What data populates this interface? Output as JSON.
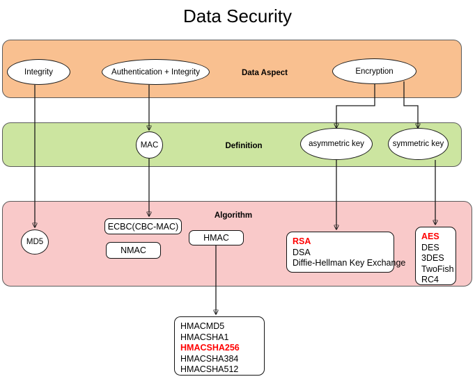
{
  "title": "Data Security",
  "bands": [
    {
      "id": "data-aspect",
      "label": "Data Aspect",
      "color": "#f9c090"
    },
    {
      "id": "definition",
      "label": "Definition",
      "color": "#cce5a0"
    },
    {
      "id": "algorithm",
      "label": "Algorithm",
      "color": "#f9c9c9"
    }
  ],
  "data_aspect": {
    "nodes": [
      {
        "id": "integrity",
        "label": "Integrity"
      },
      {
        "id": "auth-integrity",
        "label": "Authentication + Integrity"
      },
      {
        "id": "encryption",
        "label": "Encryption"
      }
    ]
  },
  "definition": {
    "nodes": [
      {
        "id": "mac",
        "label": "MAC"
      },
      {
        "id": "asymmetric-key",
        "label": "asymmetric key"
      },
      {
        "id": "symmetric-key",
        "label": "symmetric key"
      }
    ]
  },
  "algorithm": {
    "nodes": [
      {
        "id": "md5",
        "label": "MD5"
      },
      {
        "id": "ecbc",
        "label": "ECBC(CBC-MAC)"
      },
      {
        "id": "nmac",
        "label": "NMAC"
      },
      {
        "id": "hmac",
        "label": "HMAC"
      }
    ],
    "asymmetric_list": [
      {
        "text": "RSA",
        "highlight": true
      },
      {
        "text": "DSA",
        "highlight": false
      },
      {
        "text": "Diffie-Hellman Key Exchange",
        "highlight": false
      }
    ],
    "symmetric_list": [
      {
        "text": "AES",
        "highlight": true
      },
      {
        "text": "DES",
        "highlight": false
      },
      {
        "text": "3DES",
        "highlight": false
      },
      {
        "text": "TwoFish",
        "highlight": false
      },
      {
        "text": "RC4",
        "highlight": false
      }
    ]
  },
  "hmac_variants": [
    {
      "text": "HMACMD5",
      "highlight": false
    },
    {
      "text": "HMACSHA1",
      "highlight": false
    },
    {
      "text": "HMACSHA256",
      "highlight": true
    },
    {
      "text": "HMACSHA384",
      "highlight": false
    },
    {
      "text": "HMACSHA512",
      "highlight": false
    }
  ],
  "colors": {
    "data_aspect_fill": "#f9c090",
    "definition_fill": "#cce5a0",
    "algorithm_fill": "#f9c9c9",
    "highlight": "#ff0000",
    "stroke": "#1a1a1a"
  }
}
